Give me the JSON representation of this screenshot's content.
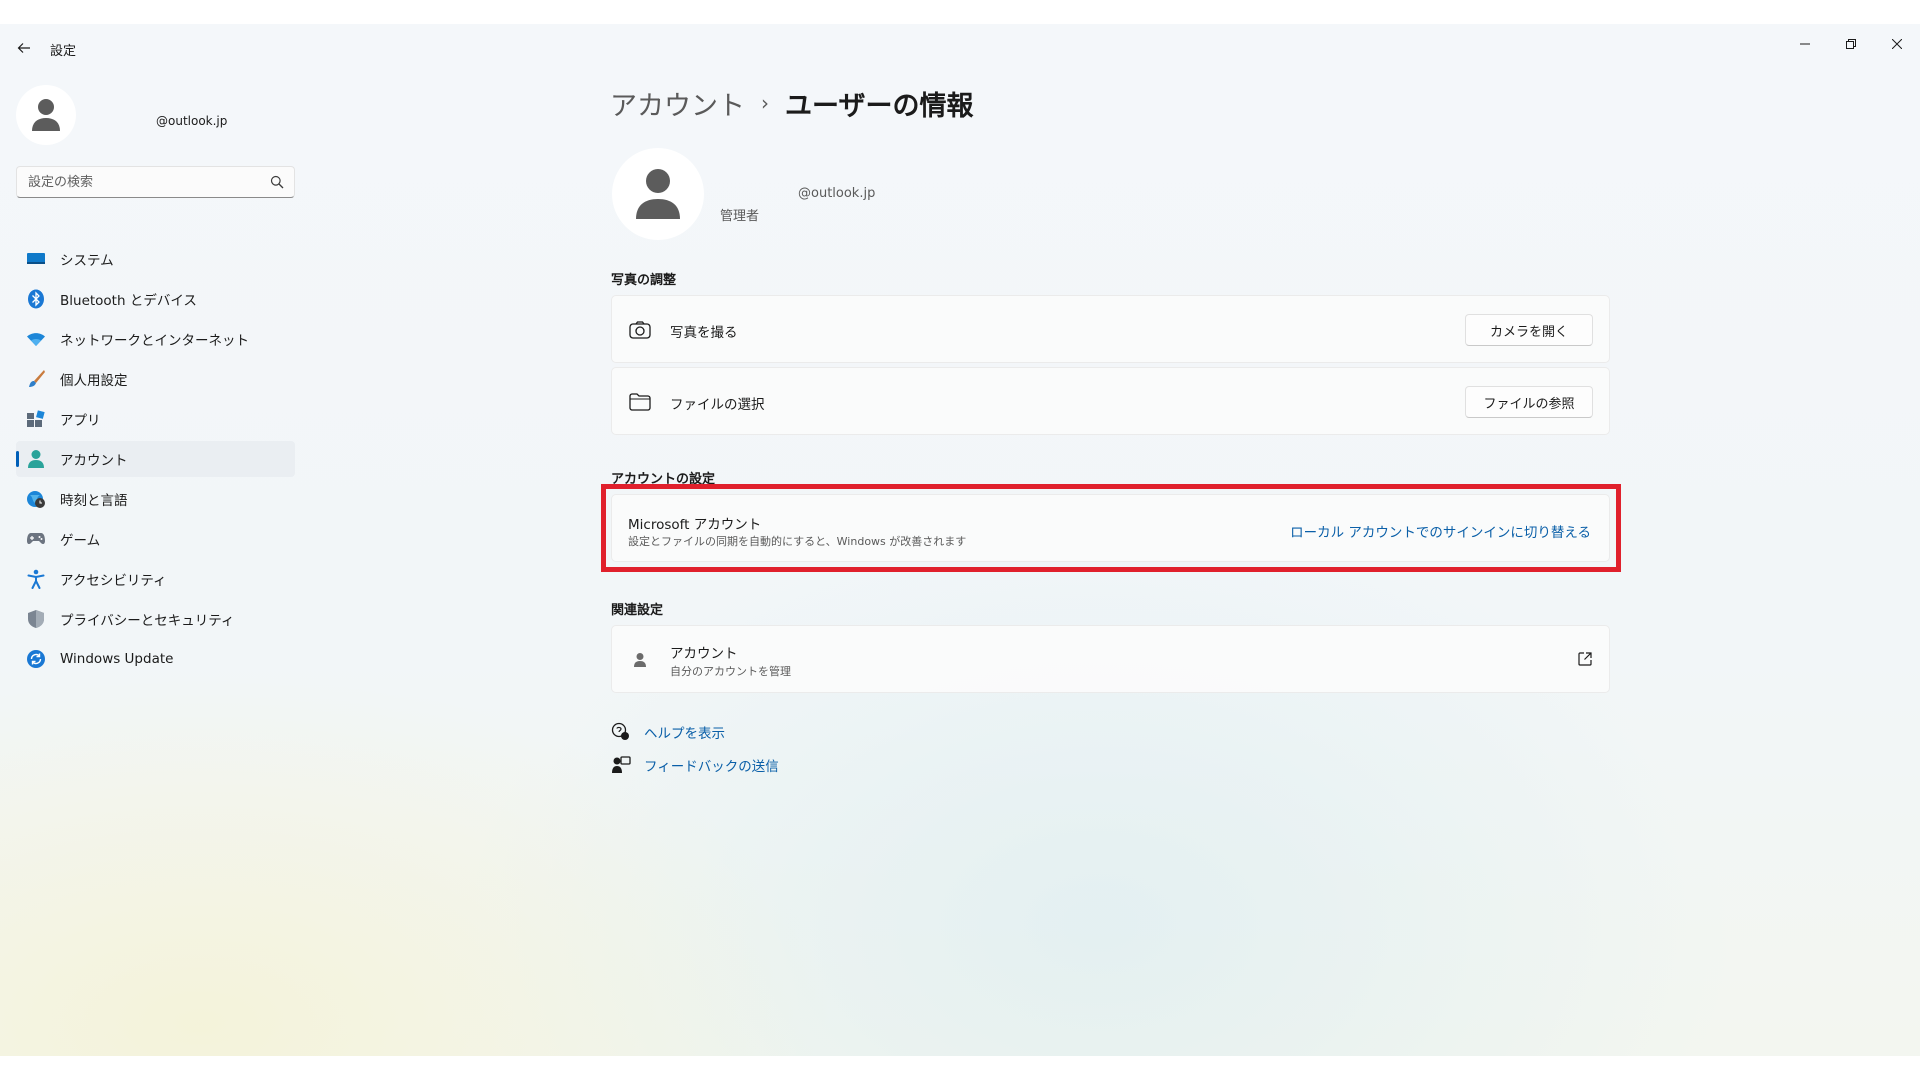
{
  "window": {
    "title": "設定",
    "controls": {
      "minimize": "minimize",
      "maximize": "maximize",
      "close": "close"
    }
  },
  "sidebar": {
    "profile": {
      "email": "@outlook.jp"
    },
    "search": {
      "placeholder": "設定の検索"
    },
    "items": [
      {
        "label": "システム",
        "icon": "system-icon",
        "active": false
      },
      {
        "label": "Bluetooth とデバイス",
        "icon": "bluetooth-icon",
        "active": false
      },
      {
        "label": "ネットワークとインターネット",
        "icon": "wifi-icon",
        "active": false
      },
      {
        "label": "個人用設定",
        "icon": "brush-icon",
        "active": false
      },
      {
        "label": "アプリ",
        "icon": "apps-icon",
        "active": false
      },
      {
        "label": "アカウント",
        "icon": "account-icon",
        "active": true
      },
      {
        "label": "時刻と言語",
        "icon": "globe-clock-icon",
        "active": false
      },
      {
        "label": "ゲーム",
        "icon": "gamepad-icon",
        "active": false
      },
      {
        "label": "アクセシビリティ",
        "icon": "accessibility-icon",
        "active": false
      },
      {
        "label": "プライバシーとセキュリティ",
        "icon": "shield-icon",
        "active": false
      },
      {
        "label": "Windows Update",
        "icon": "update-icon",
        "active": false
      }
    ]
  },
  "main": {
    "breadcrumb": {
      "parent": "アカウント",
      "separator": "›",
      "current": "ユーザーの情報"
    },
    "user": {
      "email": "@outlook.jp",
      "role": "管理者"
    },
    "photo_section": {
      "title": "写真の調整",
      "take_photo": {
        "label": "写真を撮る",
        "button": "カメラを開く"
      },
      "choose_file": {
        "label": "ファイルの選択",
        "button": "ファイルの参照"
      }
    },
    "account_section": {
      "title": "アカウントの設定",
      "microsoft_account": {
        "title": "Microsoft アカウント",
        "subtitle": "設定とファイルの同期を自動的にすると、Windows が改善されます",
        "link": "ローカル アカウントでのサインインに切り替える"
      }
    },
    "related_section": {
      "title": "関連設定",
      "accounts": {
        "title": "アカウント",
        "subtitle": "自分のアカウントを管理"
      }
    },
    "help": {
      "get_help": "ヘルプを表示",
      "feedback": "フィードバックの送信"
    }
  },
  "colors": {
    "accent": "#005fb8",
    "link": "#0a5fa8",
    "highlight": "#e0202c"
  }
}
